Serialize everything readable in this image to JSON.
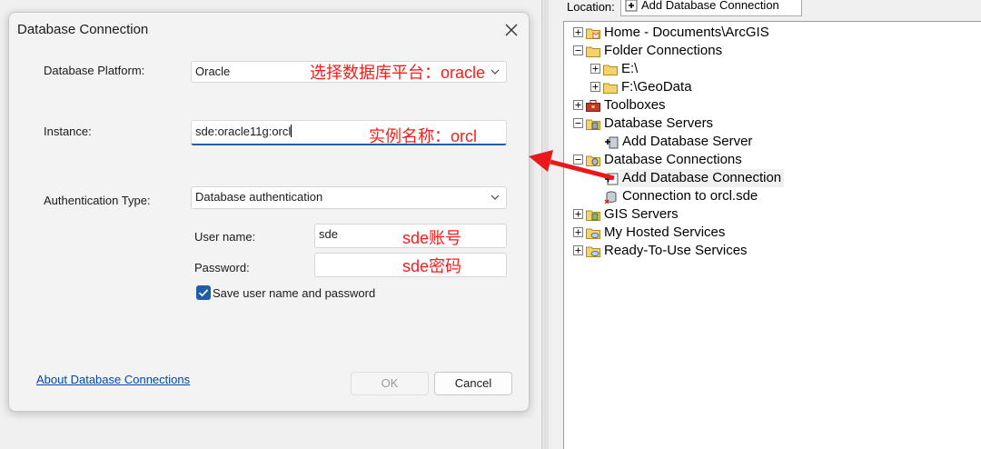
{
  "dialog": {
    "title": "Database Connection",
    "platform_label": "Database Platform:",
    "platform_value": "Oracle",
    "platform_annotation": "选择数据库平台：oracle",
    "instance_label": "Instance:",
    "instance_value": "sde:oracle11g:orcl",
    "instance_annotation": "实例名称：orcl",
    "auth_label": "Authentication Type:",
    "auth_value": "Database authentication",
    "username_label": "User name:",
    "username_value": "sde",
    "username_annotation": "sde账号",
    "password_label": "Password:",
    "password_value": "",
    "password_annotation": "sde密码",
    "save_label": "Save user name and password",
    "save_checked": true,
    "about_link": "About Database Connections",
    "ok_label": "OK",
    "cancel_label": "Cancel"
  },
  "catalog": {
    "location_label": "Location:",
    "location_value": "Add Database Connection",
    "tree": [
      {
        "label": "Home - Documents\\ArcGIS",
        "icon": "home-folder-icon",
        "expander": "plus"
      },
      {
        "label": "Folder Connections",
        "icon": "folder-icon",
        "expander": "minus"
      },
      {
        "label": "E:\\",
        "icon": "folder-icon",
        "expander": "plus"
      },
      {
        "label": "F:\\GeoData",
        "icon": "folder-icon",
        "expander": "plus"
      },
      {
        "label": "Toolboxes",
        "icon": "toolbox-icon",
        "expander": "plus"
      },
      {
        "label": "Database Servers",
        "icon": "database-server-icon",
        "expander": "minus"
      },
      {
        "label": "Add Database Server",
        "icon": "add-database-server-icon",
        "expander": ""
      },
      {
        "label": "Database Connections",
        "icon": "database-connections-icon",
        "expander": "minus"
      },
      {
        "label": "Add Database Connection",
        "icon": "add-database-connection-icon",
        "expander": ""
      },
      {
        "label": "Connection to orcl.sde",
        "icon": "database-connection-icon",
        "expander": ""
      },
      {
        "label": "GIS Servers",
        "icon": "gis-server-icon",
        "expander": "plus"
      },
      {
        "label": "My Hosted Services",
        "icon": "hosted-services-icon",
        "expander": "plus"
      },
      {
        "label": "Ready-To-Use Services",
        "icon": "ready-services-icon",
        "expander": "plus"
      }
    ]
  },
  "colors": {
    "annotation": "#ff1a1a",
    "accent": "#1f5fa8",
    "link": "#0645ad"
  }
}
